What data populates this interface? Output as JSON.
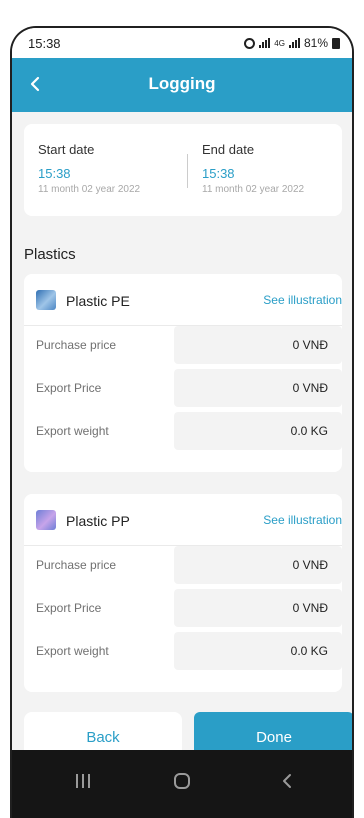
{
  "status": {
    "time": "15:38",
    "signal_label": "4G",
    "battery": "81%"
  },
  "header": {
    "title": "Logging"
  },
  "dates": {
    "start": {
      "label": "Start date",
      "time": "15:38",
      "date": "11 month 02 year 2022"
    },
    "end": {
      "label": "End date",
      "time": "15:38",
      "date": "11 month 02 year 2022"
    }
  },
  "section": {
    "title": "Plastics"
  },
  "products": [
    {
      "name": "Plastic PE",
      "link": "See illustration",
      "rows": [
        {
          "label": "Purchase price",
          "value": "0  VNĐ"
        },
        {
          "label": "Export Price",
          "value": "0  VNĐ"
        },
        {
          "label": "Export weight",
          "value": "0.0  KG"
        }
      ]
    },
    {
      "name": "Plastic PP",
      "link": "See illustration",
      "rows": [
        {
          "label": "Purchase price",
          "value": "0  VNĐ"
        },
        {
          "label": "Export Price",
          "value": "0  VNĐ"
        },
        {
          "label": "Export weight",
          "value": "0.0  KG"
        }
      ]
    }
  ],
  "actions": {
    "back_label": "Back",
    "done_label": "Done"
  },
  "colors": {
    "accent": "#2a9ec7",
    "background": "#f3f3f3",
    "nav": "#151515"
  },
  "icons": [
    "back-arrow-icon",
    "alarm-icon",
    "signal-icon",
    "battery-icon",
    "plastic-pe-icon",
    "plastic-pp-icon",
    "recent-apps-icon",
    "home-icon",
    "nav-back-icon"
  ]
}
